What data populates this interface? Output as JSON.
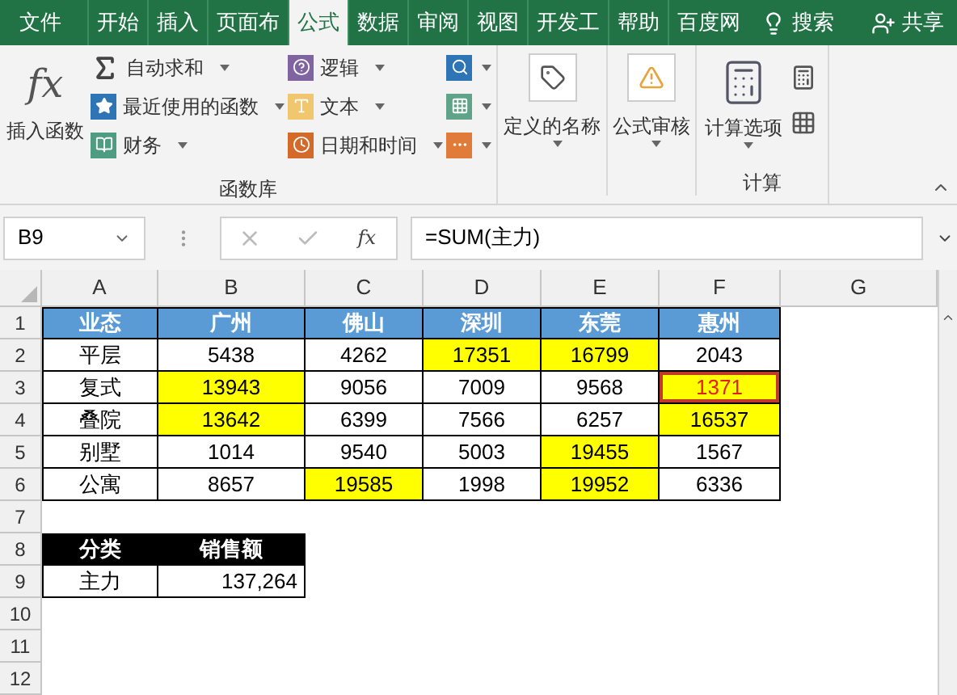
{
  "ribbon_tabs": [
    {
      "label": "文件",
      "selected": false
    },
    {
      "label": "开始",
      "selected": false
    },
    {
      "label": "插入",
      "selected": false
    },
    {
      "label": "页面布",
      "selected": false
    },
    {
      "label": "公式",
      "selected": true
    },
    {
      "label": "数据",
      "selected": false
    },
    {
      "label": "审阅",
      "selected": false
    },
    {
      "label": "视图",
      "selected": false
    },
    {
      "label": "开发工",
      "selected": false
    },
    {
      "label": "帮助",
      "selected": false
    },
    {
      "label": "百度网",
      "selected": false
    }
  ],
  "tell_me": {
    "label": "搜索"
  },
  "share": {
    "label": "共享"
  },
  "function_library": {
    "icon_text": "fx",
    "insert_function": "插入函数",
    "group_label": "函数库",
    "column_1": [
      {
        "kind": "sigma",
        "label": "自动求和"
      },
      {
        "kind": "star",
        "label": "最近使用的函数"
      },
      {
        "kind": "ledger",
        "label": "财务"
      }
    ],
    "column_2": [
      {
        "kind": "logic",
        "label": "逻辑"
      },
      {
        "kind": "text",
        "label": "文本"
      },
      {
        "kind": "clock",
        "label": "日期和时间"
      }
    ],
    "column_3": [
      {
        "kind": "lookup"
      },
      {
        "kind": "math"
      },
      {
        "kind": "more"
      }
    ]
  },
  "defined_names": {
    "label": "定义的名称"
  },
  "formula_auditing": {
    "label": "公式审核"
  },
  "calculation": {
    "label": "计算选项",
    "group_label": "计算"
  },
  "name_box": {
    "value": "B9"
  },
  "formula_bar": {
    "fx_button": "fx",
    "value": "=SUM(主力)"
  },
  "columns": [
    "A",
    "B",
    "C",
    "D",
    "E",
    "F",
    "G"
  ],
  "rows": [
    {
      "number": "1",
      "cells": [
        {
          "text": "业态",
          "kind": "header"
        },
        {
          "text": "广州",
          "kind": "header"
        },
        {
          "text": "佛山",
          "kind": "header"
        },
        {
          "text": "深圳",
          "kind": "header"
        },
        {
          "text": "东莞",
          "kind": "header"
        },
        {
          "text": "惠州",
          "kind": "header"
        }
      ]
    },
    {
      "number": "2",
      "cells": [
        {
          "text": "平层",
          "kind": "plain"
        },
        {
          "text": "5438",
          "kind": "plain"
        },
        {
          "text": "4262",
          "kind": "plain"
        },
        {
          "text": "17351",
          "kind": "yellow"
        },
        {
          "text": "16799",
          "kind": "yellow"
        },
        {
          "text": "2043",
          "kind": "plain"
        }
      ]
    },
    {
      "number": "3",
      "cells": [
        {
          "text": "复式",
          "kind": "plain"
        },
        {
          "text": "13943",
          "kind": "yellow"
        },
        {
          "text": "9056",
          "kind": "plain"
        },
        {
          "text": "7009",
          "kind": "plain"
        },
        {
          "text": "9568",
          "kind": "plain"
        },
        {
          "text": "1371",
          "kind": "flagged"
        }
      ]
    },
    {
      "number": "4",
      "cells": [
        {
          "text": "叠院",
          "kind": "plain"
        },
        {
          "text": "13642",
          "kind": "yellow"
        },
        {
          "text": "6399",
          "kind": "plain"
        },
        {
          "text": "7566",
          "kind": "plain"
        },
        {
          "text": "6257",
          "kind": "plain"
        },
        {
          "text": "16537",
          "kind": "yellow"
        }
      ]
    },
    {
      "number": "5",
      "cells": [
        {
          "text": "别墅",
          "kind": "plain"
        },
        {
          "text": "1014",
          "kind": "plain"
        },
        {
          "text": "9540",
          "kind": "plain"
        },
        {
          "text": "5003",
          "kind": "plain"
        },
        {
          "text": "19455",
          "kind": "yellow"
        },
        {
          "text": "1567",
          "kind": "plain"
        }
      ]
    },
    {
      "number": "6",
      "cells": [
        {
          "text": "公寓",
          "kind": "plain"
        },
        {
          "text": "8657",
          "kind": "plain"
        },
        {
          "text": "19585",
          "kind": "yellow"
        },
        {
          "text": "1998",
          "kind": "plain"
        },
        {
          "text": "19952",
          "kind": "yellow"
        },
        {
          "text": "6336",
          "kind": "plain"
        }
      ]
    },
    {
      "number": "7"
    },
    {
      "number": "8",
      "cells": [
        {
          "text": "分类",
          "kind": "dark-header"
        },
        {
          "text": "销售额",
          "kind": "dark-header"
        }
      ]
    },
    {
      "number": "9",
      "cells": [
        {
          "text": "主力",
          "kind": "plain"
        },
        {
          "text": "137,264",
          "kind": "number"
        }
      ]
    },
    {
      "number": "10"
    },
    {
      "number": "11"
    },
    {
      "number": "12"
    }
  ]
}
